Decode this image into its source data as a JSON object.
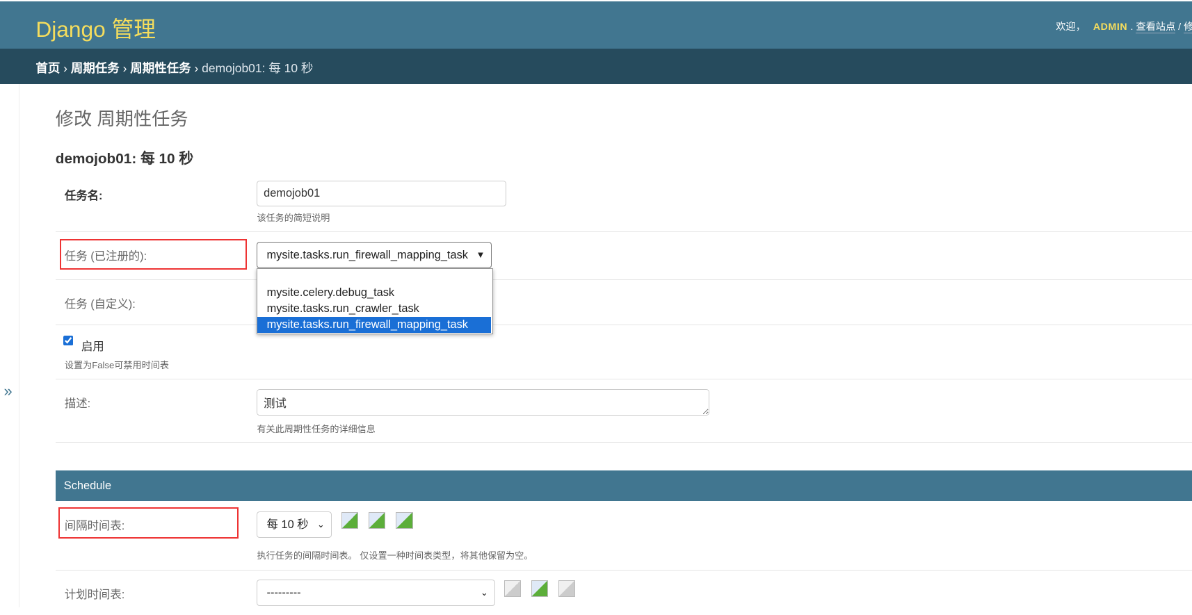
{
  "header": {
    "brand": "Django 管理",
    "welcome": "欢迎，",
    "user": "ADMIN",
    "view_site": "查看站点",
    "sep": "/",
    "more": "修"
  },
  "breadcrumbs": {
    "home": "首页",
    "app": "周期任务",
    "model": "周期性任务",
    "current": "demojob01: 每 10 秒",
    "sep": "›"
  },
  "nav_toggle": "»",
  "page_title": "修改 周期性任务",
  "object_title": "demojob01: 每 10 秒",
  "fields": {
    "name": {
      "label": "任务名:",
      "value": "demojob01",
      "help": "该任务的简短说明"
    },
    "task_registered": {
      "label": "任务 (已注册的):",
      "value": "mysite.tasks.run_firewall_mapping_task",
      "options": [
        "",
        "mysite.celery.debug_task",
        "mysite.tasks.run_crawler_task",
        "mysite.tasks.run_firewall_mapping_task"
      ]
    },
    "task_custom": {
      "label": "任务 (自定义):"
    },
    "enabled": {
      "label": "启用",
      "checked": true,
      "help": "设置为False可禁用时间表"
    },
    "description": {
      "label": "描述:",
      "value": "测试",
      "help": "有关此周期性任务的详细信息"
    }
  },
  "schedule": {
    "title": "Schedule",
    "interval": {
      "label": "间隔时间表:",
      "value": "每 10 秒",
      "help": "执行任务的间隔时间表。 仅设置一种时间表类型，将其他保留为空。"
    },
    "crontab": {
      "label": "计划时间表:",
      "value": "---------"
    }
  },
  "colors": {
    "header": "#417690",
    "breadcrumbs": "#264b5d",
    "brand": "#f5dd5d",
    "highlight": "#e33333",
    "selected": "#1a6fd6"
  }
}
